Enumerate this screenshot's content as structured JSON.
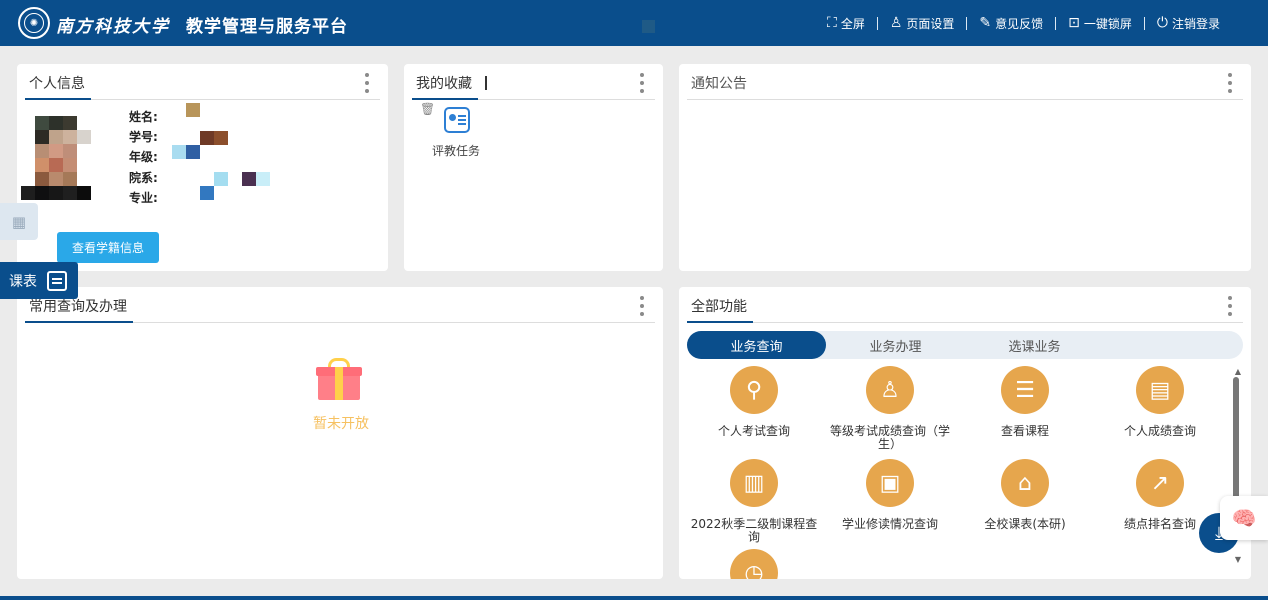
{
  "header": {
    "university": "南方科技大学",
    "title": "教学管理与服务平台",
    "nav": [
      {
        "label": "全屏",
        "icon": "fullscreen-icon",
        "glyph": "⛶"
      },
      {
        "label": "页面设置",
        "icon": "shirt-icon",
        "glyph": "👕"
      },
      {
        "label": "意见反馈",
        "icon": "feedback-icon",
        "glyph": "✎"
      },
      {
        "label": "一键锁屏",
        "icon": "lock-icon",
        "glyph": "🔒"
      },
      {
        "label": "注销登录",
        "icon": "power-icon",
        "glyph": "⏻"
      }
    ]
  },
  "personal": {
    "title": "个人信息",
    "labels": {
      "name": "姓名:",
      "student_id": "学号:",
      "grade": "年级:",
      "department": "院系:",
      "major": "专业:"
    },
    "button": "查看学籍信息"
  },
  "favorites": {
    "title": "我的收藏",
    "items": [
      {
        "label": "评教任务"
      }
    ]
  },
  "notice": {
    "title": "通知公告"
  },
  "common": {
    "title": "常用查询及办理",
    "empty": "暂未开放"
  },
  "side": {
    "timetable": "课表"
  },
  "functions": {
    "title": "全部功能",
    "tabs": [
      "业务查询",
      "业务办理",
      "选课业务"
    ],
    "active_tab": "业务查询",
    "items": [
      {
        "label": "个人考试查询",
        "glyph": "🔍"
      },
      {
        "label": "等级考试成绩查询（学生）",
        "glyph": "👤"
      },
      {
        "label": "查看课程",
        "glyph": "☰"
      },
      {
        "label": "个人成绩查询",
        "glyph": "📄"
      },
      {
        "label": "2022秋季二级制课程查询",
        "glyph": "🗎"
      },
      {
        "label": "学业修读情况查询",
        "glyph": "📋"
      },
      {
        "label": "全校课表(本研)",
        "glyph": "🎓"
      },
      {
        "label": "绩点排名查询",
        "glyph": "📈"
      },
      {
        "label": "",
        "glyph": "⏲"
      }
    ]
  },
  "colors": {
    "primary": "#0a4e8c",
    "accent": "#e6a64d",
    "button": "#2aa8e8"
  }
}
